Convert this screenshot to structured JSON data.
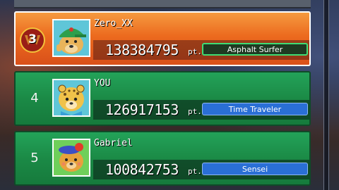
{
  "leaderboard": {
    "score_unit": "pt.",
    "entries": [
      {
        "rank": "3",
        "name": "Zero_XX",
        "score": "138384795",
        "title": "Asphalt Surfer",
        "highlighted": true,
        "title_color": "#3fdc73",
        "avatar": "pug-with-cap-avatar"
      },
      {
        "rank": "4",
        "name": "YOU",
        "score": "126917153",
        "title": "Time Traveler",
        "highlighted": false,
        "title_color": "#2a6fd6",
        "avatar": "cheetah-avatar"
      },
      {
        "rank": "5",
        "name": "Gabriel",
        "score": "100842753",
        "title": "Sensei",
        "highlighted": false,
        "title_color": "#2a6fd6",
        "avatar": "bear-with-beret-avatar"
      }
    ]
  },
  "colors": {
    "highlight_row": "#ec6a1e",
    "normal_row": "#1b8a46"
  }
}
